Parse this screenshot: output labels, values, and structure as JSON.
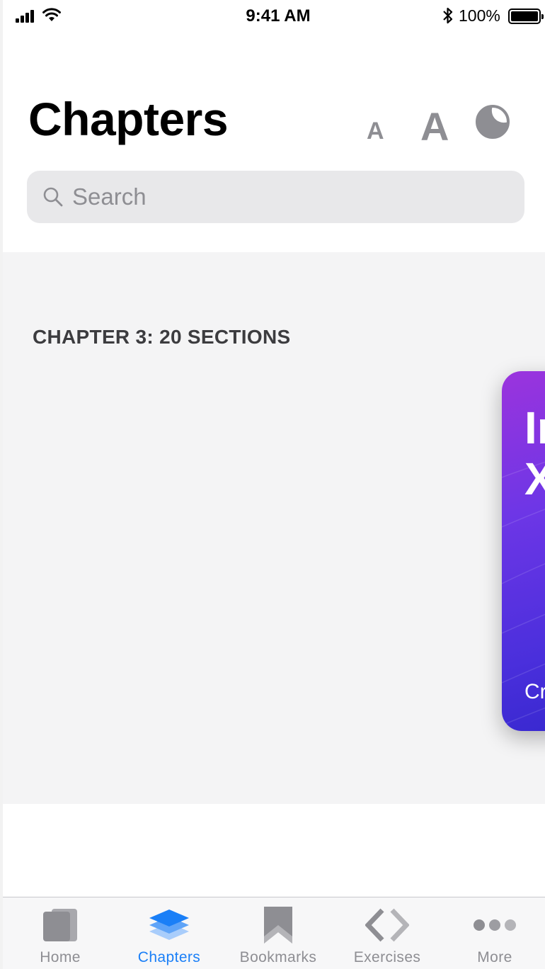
{
  "status_bar": {
    "time": "9:41 AM",
    "battery_percent": "100%",
    "icons": [
      "cellular-signal-icon",
      "wifi-icon",
      "bluetooth-icon",
      "battery-icon"
    ]
  },
  "header": {
    "title": "Chapters",
    "font_decrease_label": "A",
    "font_increase_label": "A",
    "theme_toggle_icon": "moon-icon"
  },
  "search": {
    "placeholder": "Search",
    "value": ""
  },
  "content": {
    "chapter_heading": "CHAPTER 3: 20 SECTIONS",
    "card": {
      "title_partial": "In\nX",
      "subtitle_partial": "Cr",
      "gradient_colors": [
        "#9b34dd",
        "#6d36e6",
        "#4a2fdc",
        "#2f25c9"
      ]
    }
  },
  "tab_bar": {
    "active_color": "#1a7ff7",
    "inactive_color": "#8e8e93",
    "tabs": [
      {
        "label": "Home",
        "icon": "home-icon",
        "active": false
      },
      {
        "label": "Chapters",
        "icon": "chapters-layers-icon",
        "active": true
      },
      {
        "label": "Bookmarks",
        "icon": "bookmark-icon",
        "active": false
      },
      {
        "label": "Exercises",
        "icon": "code-brackets-icon",
        "active": false
      },
      {
        "label": "More",
        "icon": "more-dots-icon",
        "active": false
      }
    ]
  }
}
